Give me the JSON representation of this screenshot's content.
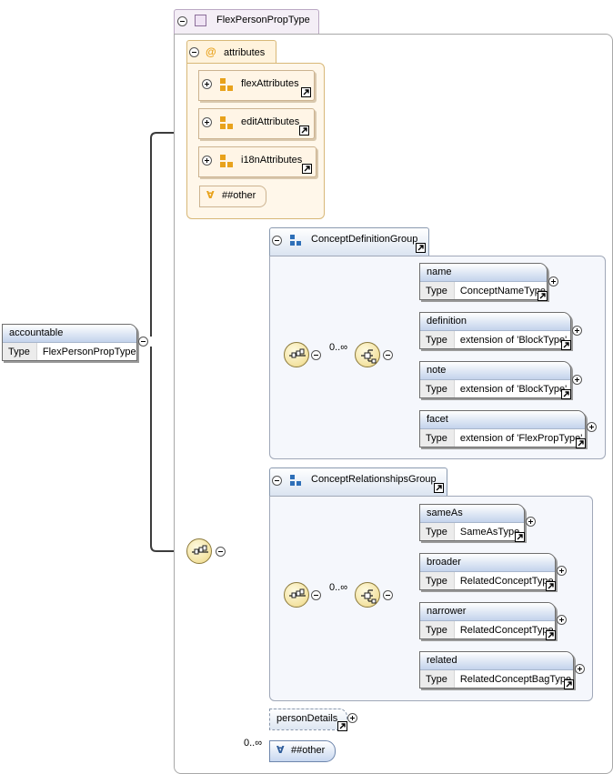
{
  "root_element": {
    "name": "accountable",
    "type_key": "Type",
    "type_value": "FlexPersonPropType"
  },
  "complex_type": {
    "name": "FlexPersonPropType"
  },
  "attributes": {
    "label": "attributes",
    "icon_glyph": "@",
    "groups": [
      {
        "name": "flexAttributes"
      },
      {
        "name": "editAttributes"
      },
      {
        "name": "i18nAttributes"
      }
    ],
    "any_attribute": {
      "glyph": "∀",
      "label": "##other"
    }
  },
  "concept_definition_group": {
    "name": "ConceptDefinitionGroup",
    "cardinality": "0..∞",
    "elements": [
      {
        "name": "name",
        "type_key": "Type",
        "type_value": "ConceptNameType"
      },
      {
        "name": "definition",
        "type_key": "Type",
        "type_value": "extension of 'BlockType'"
      },
      {
        "name": "note",
        "type_key": "Type",
        "type_value": "extension of 'BlockType'"
      },
      {
        "name": "facet",
        "type_key": "Type",
        "type_value": "extension of 'FlexPropType'"
      }
    ]
  },
  "concept_relationships_group": {
    "name": "ConceptRelationshipsGroup",
    "cardinality": "0..∞",
    "elements": [
      {
        "name": "sameAs",
        "type_key": "Type",
        "type_value": "SameAsType"
      },
      {
        "name": "broader",
        "type_key": "Type",
        "type_value": "RelatedConceptType"
      },
      {
        "name": "narrower",
        "type_key": "Type",
        "type_value": "RelatedConceptType"
      },
      {
        "name": "related",
        "type_key": "Type",
        "type_value": "RelatedConceptBagType"
      }
    ]
  },
  "person_details": {
    "name": "personDetails"
  },
  "any_element": {
    "cardinality": "0..∞",
    "glyph": "∀",
    "label": "##other"
  },
  "colors": {
    "connector": "#3c3c3c",
    "thin_connector": "#b4b4b4",
    "element_header": "#c3d3ec",
    "attribute_fill": "#fff7ea",
    "attribute_icon": "#e8a21c",
    "group_icon": "#2e6fb8",
    "complex_type_fill": "#f4eef6"
  },
  "icons": {
    "collapse": "minus-circle-icon",
    "expand": "plus-circle-icon",
    "link": "hyperlink-arrow-icon",
    "sequence": "sequence-compositor-icon",
    "attribute_group": "attribute-group-icon",
    "group": "group-icon",
    "complex_type": "complex-type-icon"
  }
}
